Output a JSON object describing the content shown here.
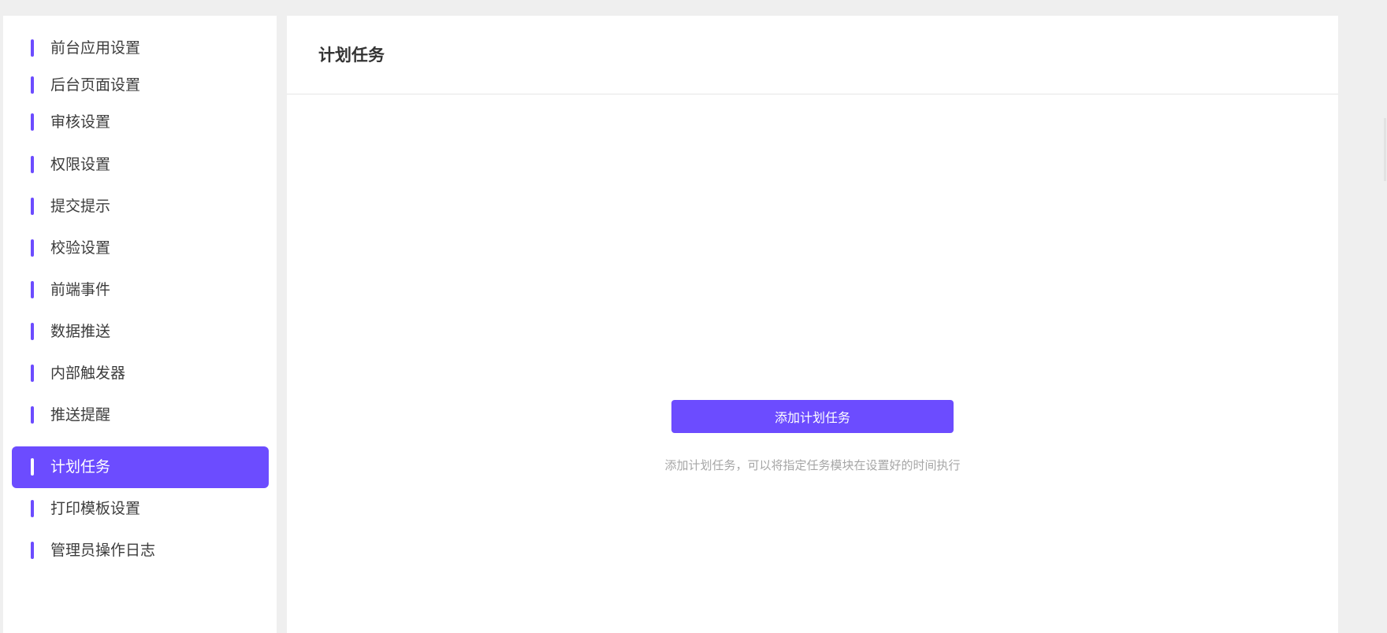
{
  "sidebar": {
    "items": [
      {
        "label": "前台应用设置",
        "active": false
      },
      {
        "label": "后台页面设置",
        "active": false
      },
      {
        "label": "审核设置",
        "active": false
      },
      {
        "label": "权限设置",
        "active": false
      },
      {
        "label": "提交提示",
        "active": false
      },
      {
        "label": "校验设置",
        "active": false
      },
      {
        "label": "前端事件",
        "active": false
      },
      {
        "label": "数据推送",
        "active": false
      },
      {
        "label": "内部触发器",
        "active": false
      },
      {
        "label": "推送提醒",
        "active": false
      },
      {
        "label": "计划任务",
        "active": true
      },
      {
        "label": "打印模板设置",
        "active": false
      },
      {
        "label": "管理员操作日志",
        "active": false
      }
    ]
  },
  "main": {
    "title": "计划任务",
    "add_button_label": "添加计划任务",
    "hint": "添加计划任务，可以将指定任务模块在设置好的时间执行"
  },
  "colors": {
    "accent": "#6c4cff",
    "background": "#efefef",
    "panel": "#ffffff",
    "hint_text": "#a6a6a6"
  }
}
